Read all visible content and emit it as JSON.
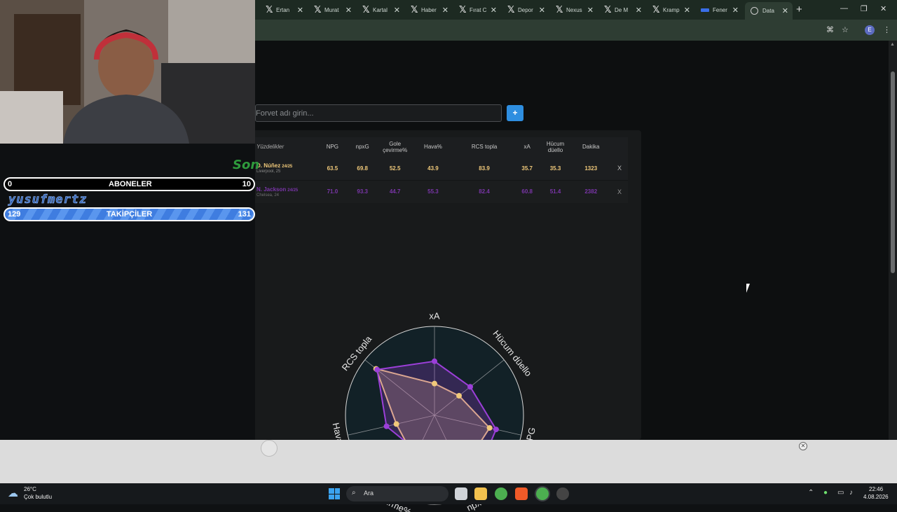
{
  "browser": {
    "tabs": [
      {
        "label": "Ertan",
        "icon": "x-icon"
      },
      {
        "label": "Murat",
        "icon": "x-icon"
      },
      {
        "label": "Kartal",
        "icon": "x-icon"
      },
      {
        "label": "Haber",
        "icon": "x-icon"
      },
      {
        "label": "Fırat C",
        "icon": "x-icon"
      },
      {
        "label": "Depor",
        "icon": "x-icon"
      },
      {
        "label": "Nexus",
        "icon": "x-icon"
      },
      {
        "label": "De M",
        "icon": "x-icon"
      },
      {
        "label": "Kramp",
        "icon": "x-icon"
      },
      {
        "label": "Fener",
        "icon": "news-icon"
      },
      {
        "label": "Data",
        "icon": "globe-icon",
        "active": true
      }
    ],
    "new_tab": "+",
    "profile_initial": "E"
  },
  "page": {
    "search_placeholder": "Forvet adı girin...",
    "add_button": "+",
    "table": {
      "headers": [
        "Yüzdelikler",
        "NPG",
        "npxG",
        "Gole çevirme%",
        "Hava%",
        "RCS topla",
        "xA",
        "Hücum düello",
        "Dakika",
        ""
      ],
      "rows": [
        {
          "name": "D. Núñez",
          "season": "24/25",
          "club": "Liverpool, 25",
          "values": [
            "63.5",
            "69.8",
            "52.5",
            "43.9",
            "83.9",
            "35.7",
            "35.3",
            "1323"
          ],
          "remove": "X",
          "color": "#f0c97a"
        },
        {
          "name": "N. Jackson",
          "season": "24/25",
          "club": "Chelsea, 24",
          "values": [
            "71.0",
            "93.3",
            "44.7",
            "55.3",
            "82.4",
            "60.8",
            "51.4",
            "2382"
          ],
          "remove": "X",
          "color": "#9b3fd8"
        }
      ]
    }
  },
  "chart_data": {
    "type": "radar",
    "axes": [
      "xA",
      "Hücum düello",
      "NPG",
      "npxG",
      "Çevirme%",
      "Hava%",
      "RCS topla"
    ],
    "range": [
      0,
      100
    ],
    "series": [
      {
        "name": "D. Núñez",
        "color": "#f0c97a",
        "values": [
          35.7,
          35.3,
          63.5,
          69.8,
          52.5,
          43.9,
          83.9
        ]
      },
      {
        "name": "N. Jackson",
        "color": "#9b3fd8",
        "values": [
          60.8,
          51.4,
          71.0,
          93.3,
          44.7,
          55.3,
          82.4
        ]
      }
    ]
  },
  "overlay": {
    "son_text": "Son",
    "subs": {
      "label": "ABONELER",
      "current": "0",
      "goal": "10"
    },
    "channel": "yusufmertz",
    "followers": {
      "label": "TAKİPÇİLER",
      "current": "129",
      "goal": "131"
    }
  },
  "taskbar": {
    "temperature": "26°C",
    "weather": "Çok bulutlu",
    "search_label": "Ara",
    "time": "22:46",
    "date": "4.08.2026"
  }
}
